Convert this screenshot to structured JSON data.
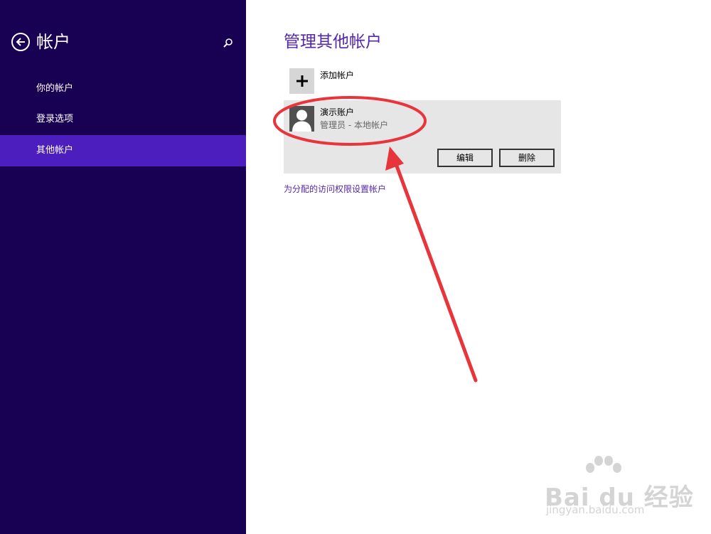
{
  "sidebar": {
    "title": "帐户",
    "items": [
      {
        "label": "你的帐户"
      },
      {
        "label": "登录选项"
      },
      {
        "label": "其他帐户",
        "active": true
      }
    ]
  },
  "main": {
    "title": "管理其他帐户",
    "add_account_label": "添加帐户",
    "account": {
      "name": "演示账户",
      "type": "管理员 - 本地帐户",
      "edit_label": "编辑",
      "delete_label": "删除"
    },
    "assigned_access_link": "为分配的访问权限设置帐户"
  },
  "watermark": {
    "brand": "Bai du 经验",
    "url": "jingyan.baidu.com"
  },
  "colors": {
    "sidebar_bg": "#180052",
    "active_item": "#4c1ebd",
    "accent": "#5527ad",
    "annotation": "#e8353b"
  },
  "icons": {
    "back": "back-arrow-icon",
    "search": "search-icon",
    "add": "plus-icon",
    "avatar": "user-silhouette-icon"
  }
}
